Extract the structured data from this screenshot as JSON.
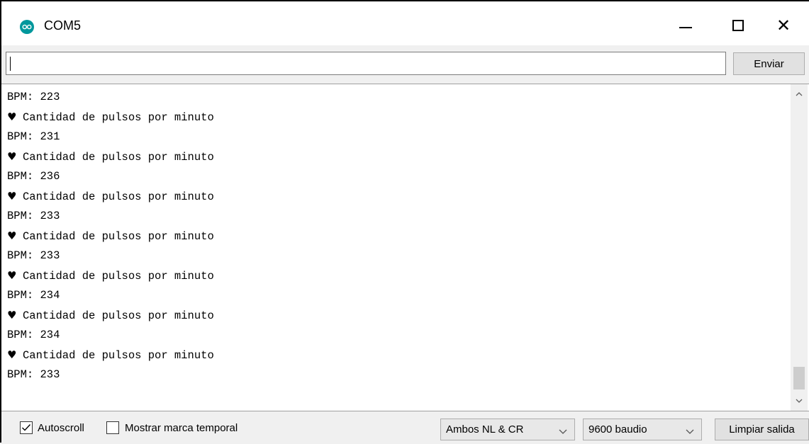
{
  "window": {
    "title": "COM5",
    "icon": "arduino-icon",
    "controls": {
      "minimize": "minimize-icon",
      "maximize": "maximize-icon",
      "close": "close-icon",
      "close_glyph": "✕"
    }
  },
  "send": {
    "input_value": "",
    "button_label": "Enviar"
  },
  "output": {
    "heart_glyph": "♥",
    "lines": [
      {
        "type": "bpm",
        "text": "BPM: 223"
      },
      {
        "type": "heart",
        "text": "Cantidad de pulsos por minuto"
      },
      {
        "type": "bpm",
        "text": "BPM: 231"
      },
      {
        "type": "heart",
        "text": "Cantidad de pulsos por minuto"
      },
      {
        "type": "bpm",
        "text": "BPM: 236"
      },
      {
        "type": "heart",
        "text": "Cantidad de pulsos por minuto"
      },
      {
        "type": "bpm",
        "text": "BPM: 233"
      },
      {
        "type": "heart",
        "text": "Cantidad de pulsos por minuto"
      },
      {
        "type": "bpm",
        "text": "BPM: 233"
      },
      {
        "type": "heart",
        "text": "Cantidad de pulsos por minuto"
      },
      {
        "type": "bpm",
        "text": "BPM: 234"
      },
      {
        "type": "heart",
        "text": "Cantidad de pulsos por minuto"
      },
      {
        "type": "bpm",
        "text": "BPM: 234"
      },
      {
        "type": "heart",
        "text": "Cantidad de pulsos por minuto"
      },
      {
        "type": "bpm",
        "text": "BPM: 233"
      }
    ]
  },
  "bottom": {
    "autoscroll_label": "Autoscroll",
    "autoscroll_checked": true,
    "timestamp_label": "Mostrar marca temporal",
    "timestamp_checked": false,
    "line_ending": "Ambos NL & CR",
    "baud_rate": "9600 baudio",
    "clear_label": "Limpiar salida"
  },
  "colors": {
    "arduino_teal": "#00979c",
    "window_bg": "#f0f0f0",
    "button_bg": "#e1e1e1"
  }
}
